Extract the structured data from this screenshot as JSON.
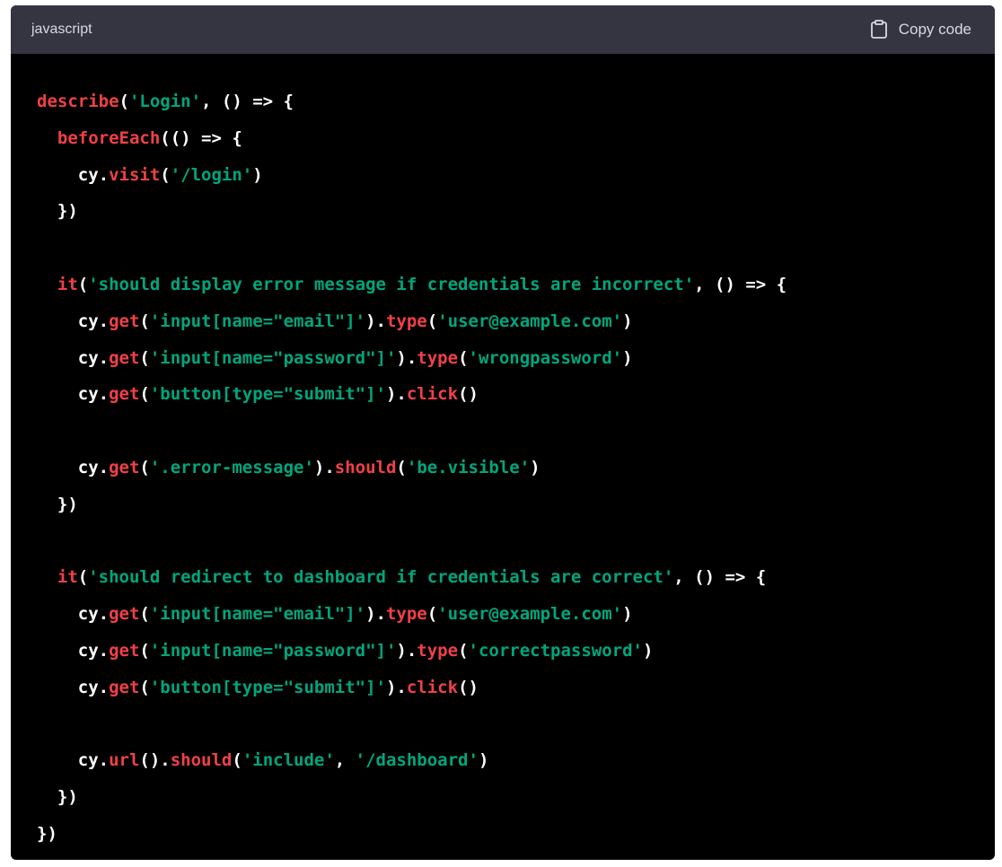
{
  "header": {
    "language": "javascript",
    "copy_label": "Copy code"
  },
  "colors": {
    "function": "#ef4146",
    "string": "#00a67d",
    "plain": "#ffffff",
    "header_bg": "#343541",
    "body_bg": "#000000"
  },
  "code_lines": [
    [
      {
        "t": "describe",
        "c": "kw"
      },
      {
        "t": "(",
        "c": "pl"
      },
      {
        "t": "'Login'",
        "c": "str"
      },
      {
        "t": ", () => {",
        "c": "pl"
      }
    ],
    [
      {
        "t": "  ",
        "c": "pl"
      },
      {
        "t": "beforeEach",
        "c": "kw"
      },
      {
        "t": "(() => {",
        "c": "pl"
      }
    ],
    [
      {
        "t": "    cy.",
        "c": "pl"
      },
      {
        "t": "visit",
        "c": "kw"
      },
      {
        "t": "(",
        "c": "pl"
      },
      {
        "t": "'/login'",
        "c": "str"
      },
      {
        "t": ")",
        "c": "pl"
      }
    ],
    [
      {
        "t": "  })",
        "c": "pl"
      }
    ],
    [],
    [
      {
        "t": "  ",
        "c": "pl"
      },
      {
        "t": "it",
        "c": "kw"
      },
      {
        "t": "(",
        "c": "pl"
      },
      {
        "t": "'should display error message if credentials are incorrect'",
        "c": "str"
      },
      {
        "t": ", () => {",
        "c": "pl"
      }
    ],
    [
      {
        "t": "    cy.",
        "c": "pl"
      },
      {
        "t": "get",
        "c": "kw"
      },
      {
        "t": "(",
        "c": "pl"
      },
      {
        "t": "'input[name=\"email\"]'",
        "c": "str"
      },
      {
        "t": ").",
        "c": "pl"
      },
      {
        "t": "type",
        "c": "kw"
      },
      {
        "t": "(",
        "c": "pl"
      },
      {
        "t": "'user@example.com'",
        "c": "str"
      },
      {
        "t": ")",
        "c": "pl"
      }
    ],
    [
      {
        "t": "    cy.",
        "c": "pl"
      },
      {
        "t": "get",
        "c": "kw"
      },
      {
        "t": "(",
        "c": "pl"
      },
      {
        "t": "'input[name=\"password\"]'",
        "c": "str"
      },
      {
        "t": ").",
        "c": "pl"
      },
      {
        "t": "type",
        "c": "kw"
      },
      {
        "t": "(",
        "c": "pl"
      },
      {
        "t": "'wrongpassword'",
        "c": "str"
      },
      {
        "t": ")",
        "c": "pl"
      }
    ],
    [
      {
        "t": "    cy.",
        "c": "pl"
      },
      {
        "t": "get",
        "c": "kw"
      },
      {
        "t": "(",
        "c": "pl"
      },
      {
        "t": "'button[type=\"submit\"]'",
        "c": "str"
      },
      {
        "t": ").",
        "c": "pl"
      },
      {
        "t": "click",
        "c": "kw"
      },
      {
        "t": "()",
        "c": "pl"
      }
    ],
    [],
    [
      {
        "t": "    cy.",
        "c": "pl"
      },
      {
        "t": "get",
        "c": "kw"
      },
      {
        "t": "(",
        "c": "pl"
      },
      {
        "t": "'.error-message'",
        "c": "str"
      },
      {
        "t": ").",
        "c": "pl"
      },
      {
        "t": "should",
        "c": "kw"
      },
      {
        "t": "(",
        "c": "pl"
      },
      {
        "t": "'be.visible'",
        "c": "str"
      },
      {
        "t": ")",
        "c": "pl"
      }
    ],
    [
      {
        "t": "  })",
        "c": "pl"
      }
    ],
    [],
    [
      {
        "t": "  ",
        "c": "pl"
      },
      {
        "t": "it",
        "c": "kw"
      },
      {
        "t": "(",
        "c": "pl"
      },
      {
        "t": "'should redirect to dashboard if credentials are correct'",
        "c": "str"
      },
      {
        "t": ", () => {",
        "c": "pl"
      }
    ],
    [
      {
        "t": "    cy.",
        "c": "pl"
      },
      {
        "t": "get",
        "c": "kw"
      },
      {
        "t": "(",
        "c": "pl"
      },
      {
        "t": "'input[name=\"email\"]'",
        "c": "str"
      },
      {
        "t": ").",
        "c": "pl"
      },
      {
        "t": "type",
        "c": "kw"
      },
      {
        "t": "(",
        "c": "pl"
      },
      {
        "t": "'user@example.com'",
        "c": "str"
      },
      {
        "t": ")",
        "c": "pl"
      }
    ],
    [
      {
        "t": "    cy.",
        "c": "pl"
      },
      {
        "t": "get",
        "c": "kw"
      },
      {
        "t": "(",
        "c": "pl"
      },
      {
        "t": "'input[name=\"password\"]'",
        "c": "str"
      },
      {
        "t": ").",
        "c": "pl"
      },
      {
        "t": "type",
        "c": "kw"
      },
      {
        "t": "(",
        "c": "pl"
      },
      {
        "t": "'correctpassword'",
        "c": "str"
      },
      {
        "t": ")",
        "c": "pl"
      }
    ],
    [
      {
        "t": "    cy.",
        "c": "pl"
      },
      {
        "t": "get",
        "c": "kw"
      },
      {
        "t": "(",
        "c": "pl"
      },
      {
        "t": "'button[type=\"submit\"]'",
        "c": "str"
      },
      {
        "t": ").",
        "c": "pl"
      },
      {
        "t": "click",
        "c": "kw"
      },
      {
        "t": "()",
        "c": "pl"
      }
    ],
    [],
    [
      {
        "t": "    cy.",
        "c": "pl"
      },
      {
        "t": "url",
        "c": "kw"
      },
      {
        "t": "().",
        "c": "pl"
      },
      {
        "t": "should",
        "c": "kw"
      },
      {
        "t": "(",
        "c": "pl"
      },
      {
        "t": "'include'",
        "c": "str"
      },
      {
        "t": ", ",
        "c": "pl"
      },
      {
        "t": "'/dashboard'",
        "c": "str"
      },
      {
        "t": ")",
        "c": "pl"
      }
    ],
    [
      {
        "t": "  })",
        "c": "pl"
      }
    ],
    [
      {
        "t": "})",
        "c": "pl"
      }
    ]
  ]
}
